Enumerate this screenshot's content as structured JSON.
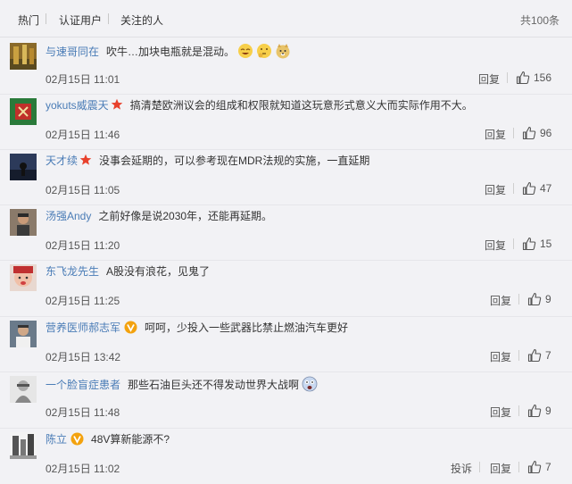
{
  "tabs": {
    "hot": "热门",
    "verified": "认证用户",
    "following": "关注的人"
  },
  "total": "共100条",
  "comments": [
    {
      "user": "与速哥同在",
      "text": "吹牛…加块电瓶就是混动。",
      "time": "02月15日 11:01",
      "reply": "回复",
      "likes": "156"
    },
    {
      "user": "yokuts威震天",
      "text": "搞清楚欧洲议会的组成和权限就知道这玩意形式意义大而实际作用不大。",
      "time": "02月15日 11:46",
      "reply": "回复",
      "likes": "96"
    },
    {
      "user": "天才续",
      "text": "没事会延期的，可以参考现在MDR法规的实施，一直延期",
      "time": "02月15日 11:05",
      "reply": "回复",
      "likes": "47"
    },
    {
      "user": "汤强Andy",
      "text": "之前好像是说2030年，还能再延期。",
      "time": "02月15日 11:20",
      "reply": "回复",
      "likes": "15"
    },
    {
      "user": "东飞龙先生",
      "text": "A股没有浪花，见鬼了",
      "time": "02月15日 11:25",
      "reply": "回复",
      "likes": "9"
    },
    {
      "user": "营养医师郝志军",
      "text": "呵呵，少投入一些武器比禁止燃油汽车更好",
      "time": "02月15日 13:42",
      "reply": "回复",
      "likes": "7"
    },
    {
      "user": "一个脸盲症患者",
      "text": "那些石油巨头还不得发动世界大战啊",
      "time": "02月15日 11:48",
      "reply": "回复",
      "likes": "9"
    },
    {
      "user": "陈立",
      "text": "48V算新能源不?",
      "time": "02月15日 11:02",
      "reply": "回复",
      "report": "投诉",
      "likes": "7"
    }
  ]
}
